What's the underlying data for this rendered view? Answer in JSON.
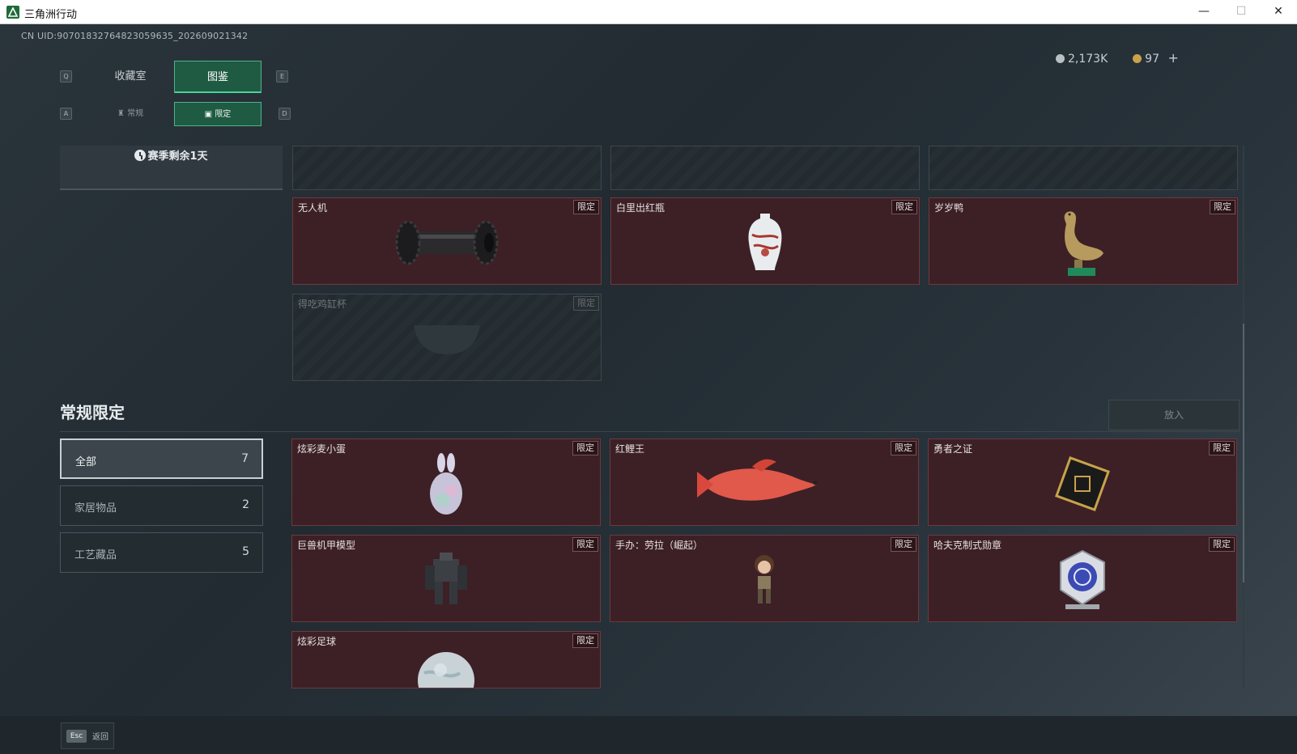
{
  "window": {
    "title": "三角洲行动",
    "min": "—",
    "max": "☐",
    "close": "✕"
  },
  "uid": "CN UID:9070183276482305963​5_202609021342",
  "currency": {
    "coin1": "2,173K",
    "coin2": "97",
    "plus": "+"
  },
  "keys": {
    "q": "Q",
    "e": "E",
    "a": "A",
    "d": "D"
  },
  "tabs": [
    "收藏室",
    "图鉴"
  ],
  "subtabs": [
    "常规",
    "限定"
  ],
  "season": "赛季剩余1天",
  "top_cards": [
    {
      "name": "无人机",
      "tag": "限定",
      "locked": false,
      "icon": "drone-roller-icon"
    },
    {
      "name": "白里出红瓶",
      "tag": "限定",
      "locked": false,
      "icon": "porcelain-vase-icon"
    },
    {
      "name": "岁岁鸭",
      "tag": "限定",
      "locked": false,
      "icon": "duck-statue-icon"
    },
    {
      "name": "得吃鸡缸杯",
      "tag": "限定",
      "locked": true,
      "icon": "cup-icon"
    }
  ],
  "section": {
    "title": "常规限定",
    "put_button": "放入"
  },
  "categories": [
    {
      "label": "全部",
      "count": "7"
    },
    {
      "label": "家居物品",
      "count": "2"
    },
    {
      "label": "工艺藏品",
      "count": "5"
    }
  ],
  "cards": [
    {
      "name": "炫彩麦小蛋",
      "tag": "限定",
      "icon": "egg-bunny-icon"
    },
    {
      "name": "红鲤王",
      "tag": "限定",
      "icon": "red-carp-icon"
    },
    {
      "name": "勇者之证",
      "tag": "限定",
      "icon": "badge-icon"
    },
    {
      "name": "巨兽机甲模型",
      "tag": "限定",
      "icon": "mech-model-icon"
    },
    {
      "name": "手办：劳拉（崛起）",
      "tag": "限定",
      "icon": "figure-icon"
    },
    {
      "name": "哈夫克制式勋章",
      "tag": "限定",
      "icon": "medal-icon"
    },
    {
      "name": "炫彩足球",
      "tag": "限定",
      "icon": "football-icon"
    }
  ],
  "footer": {
    "esc_key": "Esc",
    "esc_label": "返回"
  }
}
